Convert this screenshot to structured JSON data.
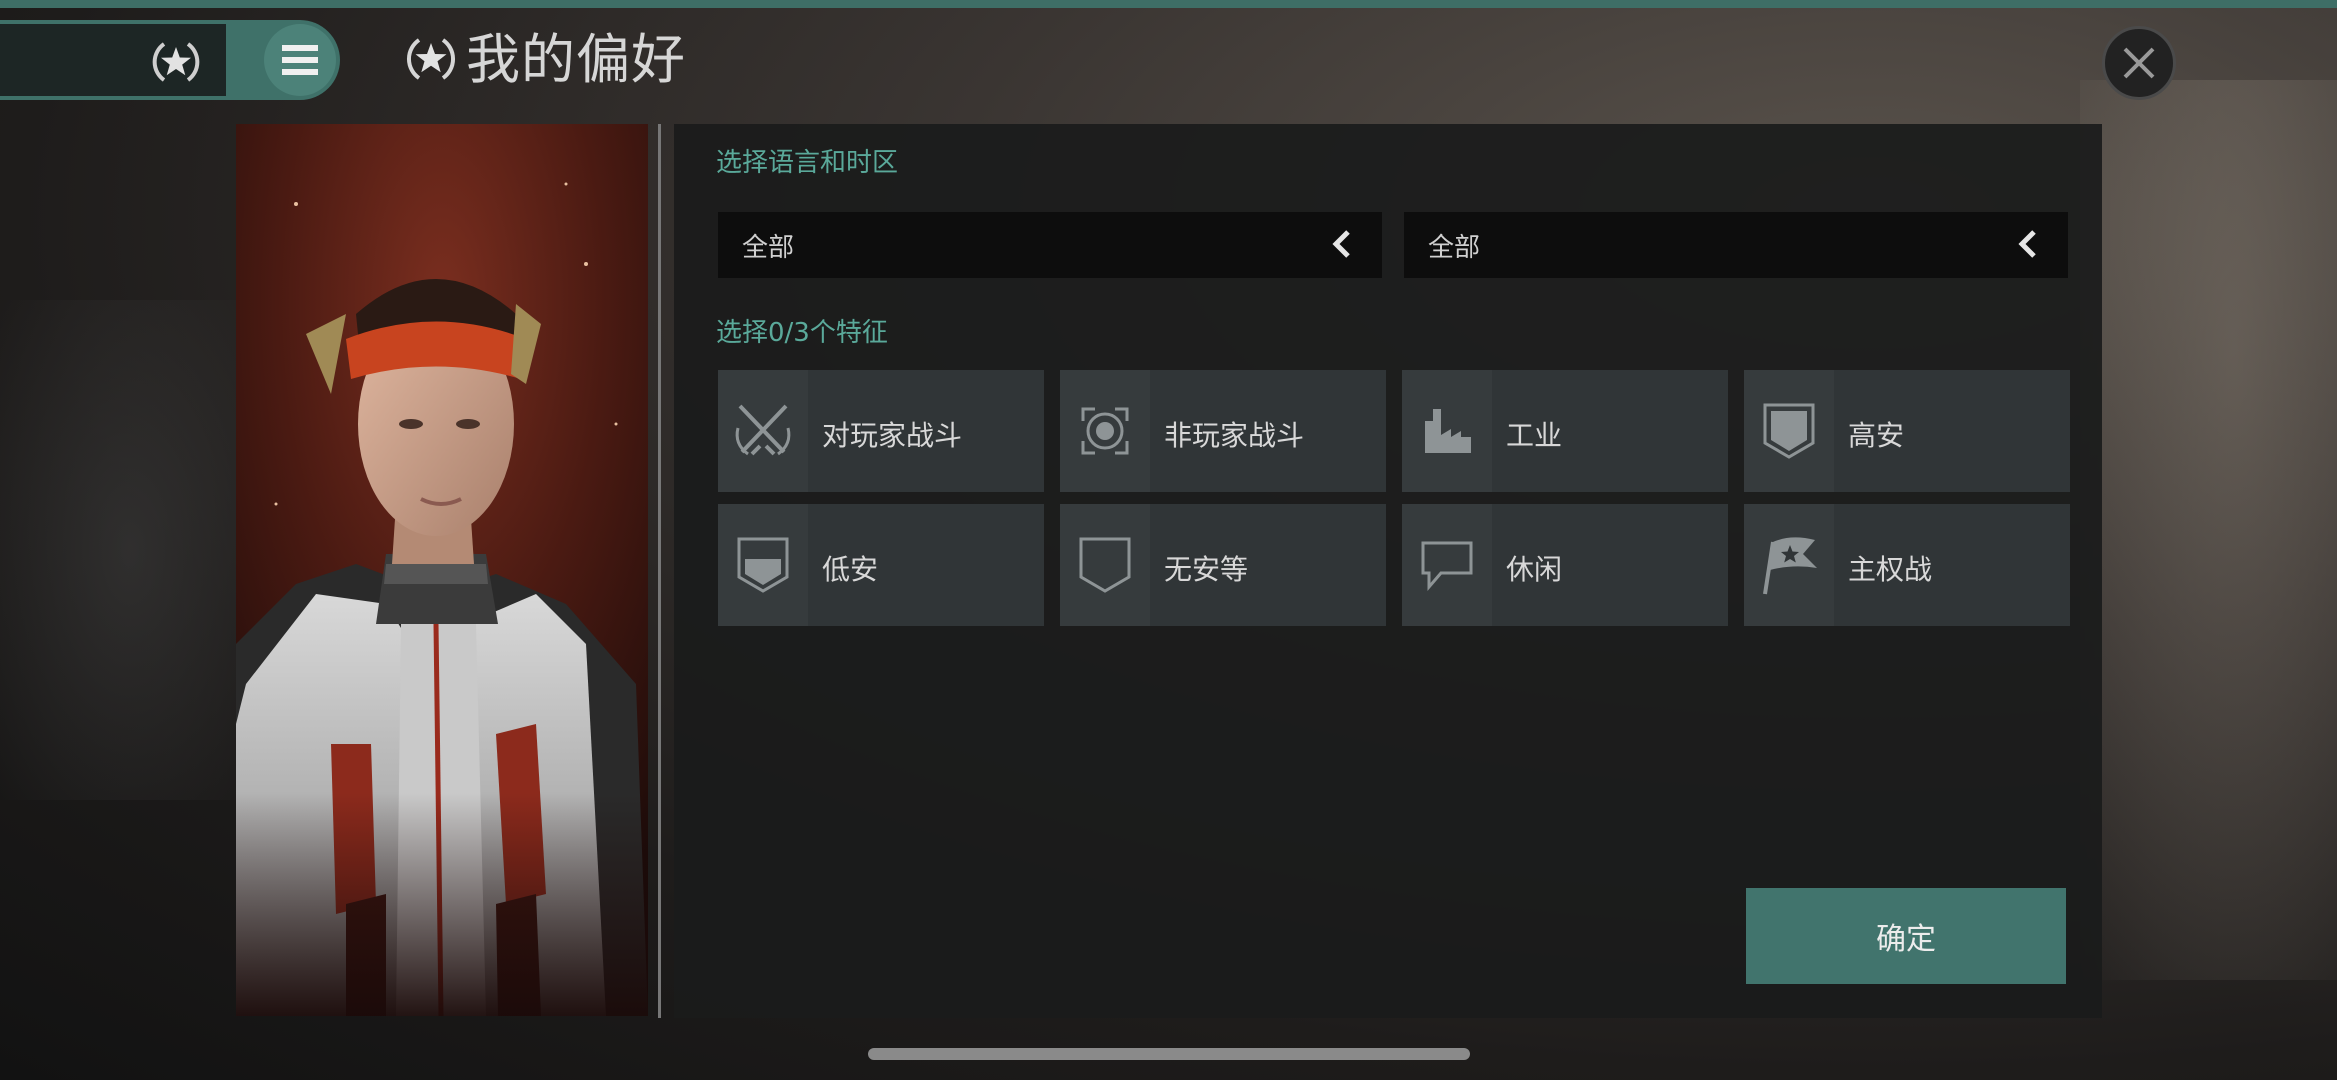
{
  "header": {
    "title": "我的偏好",
    "rank_icon": "star-circle-icon",
    "menu_icon": "hamburger-menu-icon",
    "close_icon": "close-x-icon"
  },
  "portrait": {
    "icon": "character-portrait"
  },
  "language_section": {
    "label": "选择语言和时区",
    "language_dropdown": {
      "value": "全部",
      "icon": "chevron-left-icon"
    },
    "timezone_dropdown": {
      "value": "全部",
      "icon": "chevron-left-icon"
    }
  },
  "traits_section": {
    "label": "选择0/3个特征",
    "items": [
      {
        "label": "对玩家战斗",
        "icon": "crossed-swords-icon"
      },
      {
        "label": "非玩家战斗",
        "icon": "target-reticle-icon"
      },
      {
        "label": "工业",
        "icon": "factory-icon"
      },
      {
        "label": "高安",
        "icon": "shield-full-icon"
      },
      {
        "label": "低安",
        "icon": "shield-half-icon"
      },
      {
        "label": "无安等",
        "icon": "shield-empty-icon"
      },
      {
        "label": "休闲",
        "icon": "chat-bubble-icon"
      },
      {
        "label": "主权战",
        "icon": "star-flag-icon"
      }
    ]
  },
  "confirm_button": {
    "label": "确定"
  },
  "colors": {
    "accent": "#41746d",
    "label_green": "#5aa99a",
    "panel_bg": "#1a1b1b",
    "tile_bg": "#303537"
  }
}
